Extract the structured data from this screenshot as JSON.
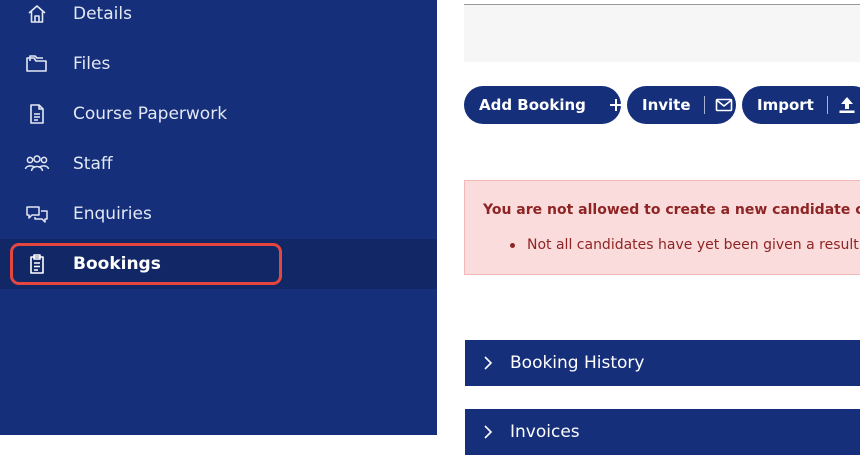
{
  "sidebar": {
    "items": [
      {
        "label": "Details",
        "icon": "home-icon"
      },
      {
        "label": "Files",
        "icon": "folder-icon"
      },
      {
        "label": "Course Paperwork",
        "icon": "document-icon"
      },
      {
        "label": "Staff",
        "icon": "users-icon"
      },
      {
        "label": "Enquiries",
        "icon": "chat-icon"
      },
      {
        "label": "Bookings",
        "icon": "clipboard-icon",
        "active": true
      }
    ]
  },
  "toolbar": {
    "add_booking_label": "Add Booking",
    "invite_label": "Invite",
    "import_label": "Import"
  },
  "alert": {
    "title": "You are not allowed to create a new candidate cours",
    "items": [
      "Not all candidates have yet been given a result o"
    ]
  },
  "sections": [
    {
      "label": "Booking History"
    },
    {
      "label": "Invoices"
    }
  ],
  "colors": {
    "sidebar_bg": "#152f7a",
    "active_bg": "#112766",
    "highlight": "#e5473f",
    "alert_bg": "#fbdcdc",
    "alert_text": "#8f2424",
    "button_bg": "#152f7a"
  }
}
